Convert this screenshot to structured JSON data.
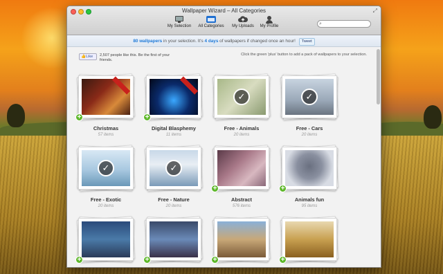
{
  "window": {
    "title": "Wallpaper Wizard – All Categories"
  },
  "toolbar": {
    "items": [
      {
        "label": "My Selection",
        "icon": "monitor-icon"
      },
      {
        "label": "All Categories",
        "icon": "folder-icon",
        "active": true
      },
      {
        "label": "My Uploads",
        "icon": "cloud-upload-icon"
      },
      {
        "label": "My Profile",
        "icon": "person-icon"
      }
    ]
  },
  "search": {
    "placeholder": ""
  },
  "info": {
    "count": "80 wallpapers",
    "pre": " in your selection. It's ",
    "days": "4 days",
    "post": " of wallpapers if changed once an hour!",
    "tweet": "Tweet"
  },
  "social": {
    "like": "Like",
    "text": "2,507 people like this. Be the first of your friends."
  },
  "hint": "Click the green 'plus' button to add a pack of wallpapers to your selection.",
  "colors": {
    "accent": "#1f7ad8",
    "plus": "#5fb82c",
    "ribbon": "#c8211c"
  },
  "tiles": [
    {
      "name": "Christmas",
      "count": "57 items",
      "state": "new",
      "bg": "linear-gradient(135deg,#3a1a10,#8a2a18 40%,#d88a3a 70%,#4a2012)"
    },
    {
      "name": "Digital Blasphemy",
      "count": "11 items",
      "state": "new",
      "bg": "radial-gradient(circle at 50% 60%,#3aa8ff,#0a2a6a 50%,#020818)"
    },
    {
      "name": "Free - Animals",
      "count": "20 items",
      "state": "selected",
      "bg": "linear-gradient(135deg,#a8b888,#d8dcc0 50%,#8a9a70)"
    },
    {
      "name": "Free - Cars",
      "count": "20 items",
      "state": "selected",
      "bg": "linear-gradient(180deg,#c8d4e0,#9aa8b8 60%,#6a7480)"
    },
    {
      "name": "Free - Exotic",
      "count": "20 items",
      "state": "selected",
      "bg": "linear-gradient(180deg,#d8e8f4,#a8c8e0 55%,#6a98b8)"
    },
    {
      "name": "Free - Nature",
      "count": "20 items",
      "state": "selected",
      "bg": "linear-gradient(180deg,#c8d8e8,#e8eef4 40%,#7a9ab8)"
    },
    {
      "name": "Abstract",
      "count": "576 items",
      "state": "add",
      "bg": "linear-gradient(135deg,#5a3a48,#a87888 40%,#d8b8c0 70%,#8a6878)"
    },
    {
      "name": "Animals fun",
      "count": "95 items",
      "state": "add",
      "bg": "radial-gradient(circle at 50% 45%,#6a7080,#8a90a0 40%,#d8dce4 75%)"
    },
    {
      "name": "",
      "count": "",
      "state": "add",
      "bg": "linear-gradient(180deg,#2a4a7a,#4a7aa8 50%,#2a3a58)"
    },
    {
      "name": "",
      "count": "",
      "state": "add",
      "bg": "linear-gradient(180deg,#3a4a6a,#6a8ab8 50%,#3a3048)"
    },
    {
      "name": "",
      "count": "",
      "state": "add",
      "bg": "linear-gradient(180deg,#8ab0d8,#c8a878 50%,#7a5a38)"
    },
    {
      "name": "",
      "count": "",
      "state": "add",
      "bg": "linear-gradient(180deg,#e8d8b0,#c8a050 50%,#8a6020)"
    }
  ]
}
